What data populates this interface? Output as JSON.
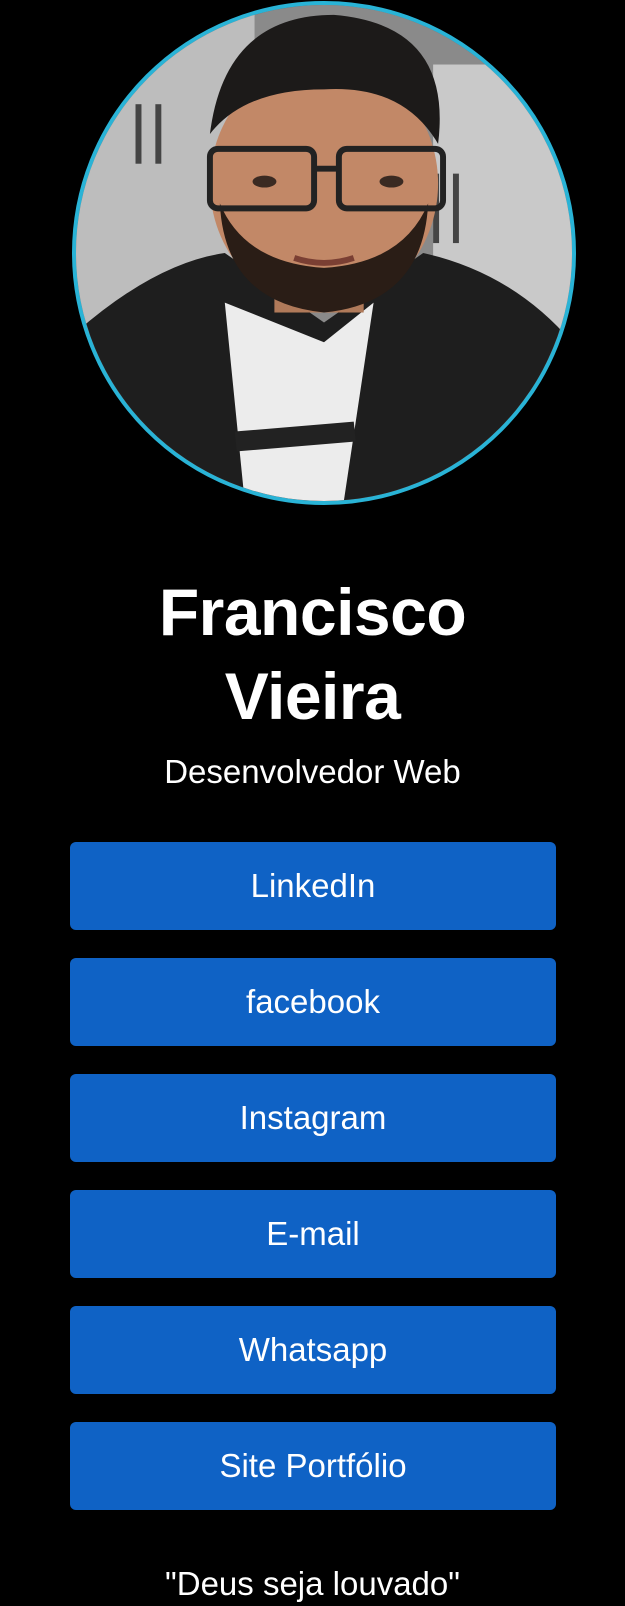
{
  "profile": {
    "name_line1": "Francisco",
    "name_line2": "Vieira",
    "title": "Desenvolvedor Web",
    "avatar_icon": "profile-photo",
    "avatar_border_color": "#29b3d6"
  },
  "links": [
    {
      "label": "LinkedIn"
    },
    {
      "label": "facebook"
    },
    {
      "label": "Instagram"
    },
    {
      "label": "E-mail"
    },
    {
      "label": "Whatsapp"
    },
    {
      "label": "Site Portfólio"
    }
  ],
  "footer": {
    "quote": "\"Deus seja louvado\""
  },
  "colors": {
    "background": "#000000",
    "button": "#0f62c5",
    "text": "#ffffff"
  }
}
